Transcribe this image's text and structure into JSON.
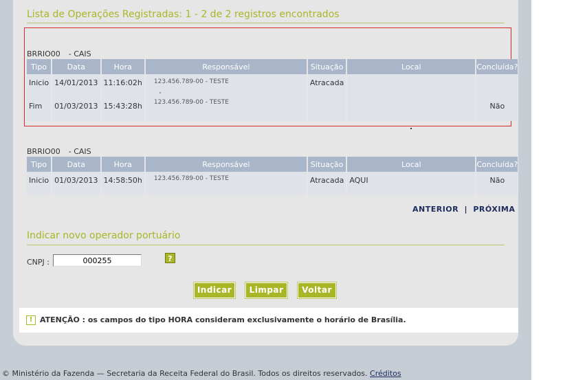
{
  "list": {
    "title": "Lista de Operações Registradas: 1 - 2 de 2 registros encontrados",
    "columns": [
      "Tipo",
      "Data",
      "Hora",
      "Responsável",
      "Situação",
      "Local",
      "Concluída?"
    ],
    "groups": [
      {
        "code": "BRRIO00",
        "name": "- CAIS",
        "rows": [
          {
            "tipo": "Inicio",
            "data": "14/01/2013",
            "hora": "11:16:02h",
            "responsavel": "123.456.789-00 - TESTE",
            "situacao": "Atracada",
            "local": "",
            "concluida": ""
          },
          {
            "tipo": "Fim",
            "data": "01/03/2013",
            "hora": "15:43:28h",
            "responsavel": "123.456.789-00 - TESTE",
            "situacao": "",
            "local": "",
            "concluida": "Não"
          }
        ]
      },
      {
        "code": "BRRIO00",
        "name": "- CAIS",
        "rows": [
          {
            "tipo": "Inicio",
            "data": "01/03/2013",
            "hora": "14:58:50h",
            "responsavel": "123.456.789-00 - TESTE",
            "situacao": "Atracada",
            "local": "AQUI",
            "concluida": "Não"
          }
        ]
      }
    ]
  },
  "pager": {
    "prev": "ANTERIOR",
    "sep": "|",
    "next": "PRÓXIMA"
  },
  "operator": {
    "title": "Indicar novo operador portuário",
    "cnpj_label": "CNPJ :",
    "cnpj_value": "000255",
    "help_label": "?"
  },
  "buttons": {
    "indicar": "Indicar",
    "limpar": "Limpar",
    "voltar": "Voltar"
  },
  "notice": {
    "icon": "!",
    "text": "ATENÇÃO : os campos do tipo HORA consideram exclusivamente o horário de Brasília."
  },
  "footer": {
    "text": "© Ministério da Fazenda — Secretaria da Receita Federal do Brasil. Todos os direitos reservados.",
    "link": "Créditos"
  },
  "colors": {
    "accent": "#a9b627",
    "header_bg": "#a9b6c9",
    "row_bg": "#dfe3e9",
    "highlight_border": "#d9292b",
    "link": "#1b2b5e"
  }
}
